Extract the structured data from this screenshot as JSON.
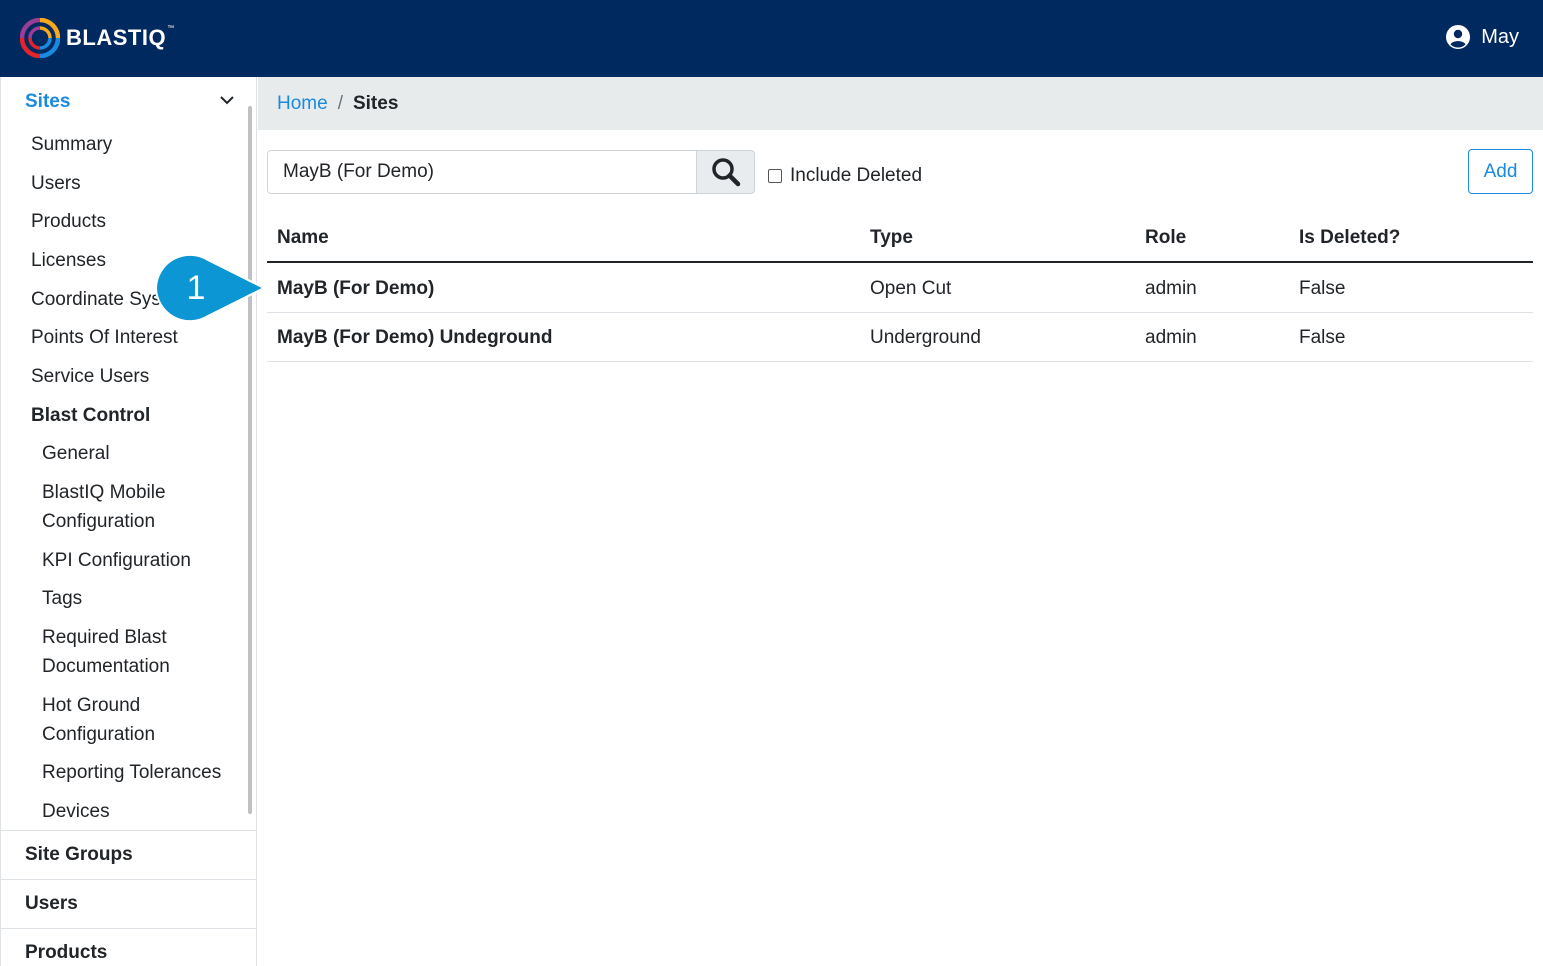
{
  "app": {
    "logo_text": "BLASTIQ",
    "logo_tm": "™"
  },
  "user": {
    "name": "May"
  },
  "sidebar": {
    "sites_label": "Sites",
    "items": [
      {
        "label": "Summary"
      },
      {
        "label": "Users"
      },
      {
        "label": "Products"
      },
      {
        "label": "Licenses"
      },
      {
        "label": "Coordinate Sys"
      },
      {
        "label": "Points Of Interest"
      },
      {
        "label": "Service Users"
      },
      {
        "label": "Blast Control"
      }
    ],
    "blast_control_items": [
      {
        "label": "General"
      },
      {
        "label": "BlastIQ Mobile"
      },
      {
        "label": "Configuration"
      },
      {
        "label": "KPI Configuration"
      },
      {
        "label": "Tags"
      },
      {
        "label": "Required Blast"
      },
      {
        "label": "Documentation"
      },
      {
        "label": "Hot Ground"
      },
      {
        "label": "Configuration"
      },
      {
        "label": "Reporting Tolerances"
      },
      {
        "label": "Devices"
      }
    ],
    "site_groups_label": "Site Groups",
    "users_label": "Users",
    "products_label": "Products"
  },
  "breadcrumb": {
    "home": "Home",
    "separator": "/",
    "current": "Sites"
  },
  "search": {
    "value": "MayB (For Demo)"
  },
  "include_deleted_label": "Include Deleted",
  "add_label": "Add",
  "table": {
    "headers": {
      "name": "Name",
      "type": "Type",
      "role": "Role",
      "deleted": "Is Deleted?"
    },
    "rows": [
      {
        "name": "MayB (For Demo)",
        "type": "Open Cut",
        "role": "admin",
        "deleted": "False"
      },
      {
        "name": "MayB (For Demo) Undeground",
        "type": "Underground",
        "role": "admin",
        "deleted": "False"
      }
    ]
  },
  "callout": {
    "number": "1"
  },
  "colors": {
    "header_bg": "#002960",
    "accent": "#1a8ae0",
    "callout": "#0d96d4"
  }
}
